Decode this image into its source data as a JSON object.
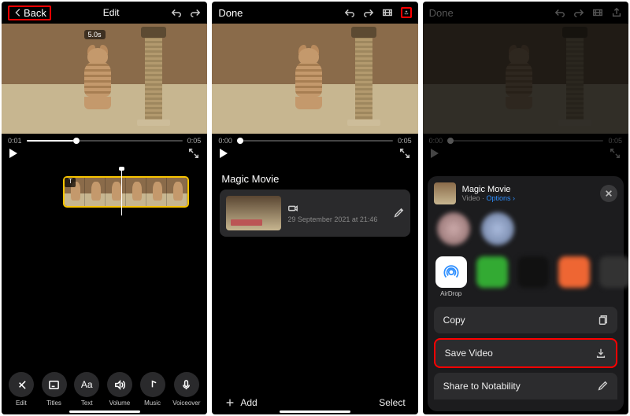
{
  "screen1": {
    "back": "Back",
    "title": "Edit",
    "badge": "5.0s",
    "time_start": "0:01",
    "time_end": "0:05",
    "timeline_marker": "T",
    "tools": [
      {
        "id": "edit",
        "label": "Edit",
        "icon": "scissors"
      },
      {
        "id": "titles",
        "label": "Titles",
        "icon": "text-frame"
      },
      {
        "id": "text",
        "label": "Text",
        "icon": "Aa"
      },
      {
        "id": "volume",
        "label": "Volume",
        "icon": "speaker"
      },
      {
        "id": "music",
        "label": "Music",
        "icon": "note"
      },
      {
        "id": "voiceover",
        "label": "Voiceover",
        "icon": "mic"
      }
    ]
  },
  "screen2": {
    "done": "Done",
    "time_start": "0:00",
    "time_end": "0:05",
    "section": "Magic Movie",
    "project_date": "29 September 2021 at 21:46",
    "add": "Add",
    "select": "Select"
  },
  "screen3": {
    "done": "Done",
    "time_start": "0:00",
    "time_end": "0:05",
    "sheet_title": "Magic Movie",
    "sheet_type": "Video",
    "sheet_options": "Options",
    "airdrop": "AirDrop",
    "actions": {
      "copy": "Copy",
      "save": "Save Video",
      "share_notability": "Share to Notability"
    }
  }
}
